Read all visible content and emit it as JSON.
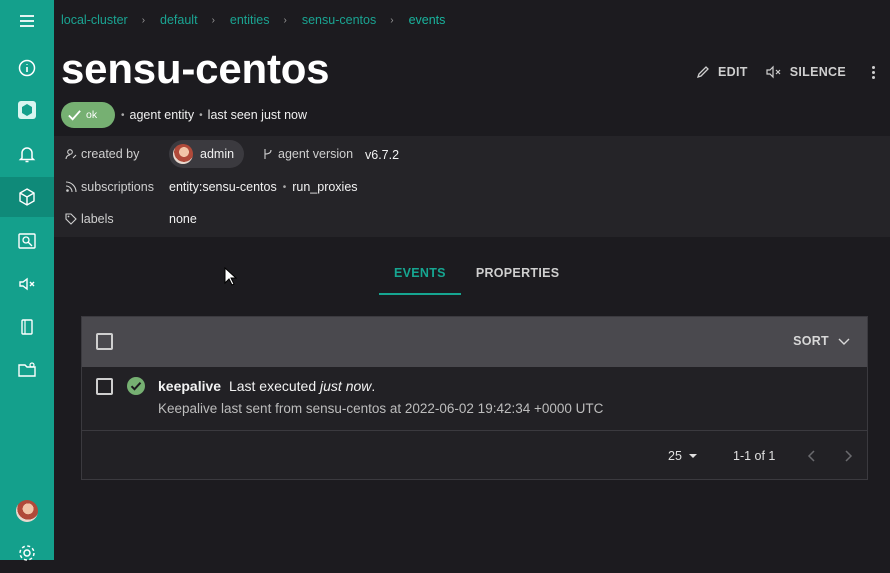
{
  "breadcrumb": [
    "local-cluster",
    "default",
    "entities",
    "sensu-centos",
    "events"
  ],
  "entity": {
    "name": "sensu-centos",
    "status": "ok",
    "class": "agent entity",
    "last_seen": "last seen just now"
  },
  "actions": {
    "edit": "EDIT",
    "silence": "SILENCE"
  },
  "meta": {
    "created_by_label": "created by",
    "created_by": "admin",
    "agent_version_label": "agent version",
    "agent_version": "v6.7.2",
    "subscriptions_label": "subscriptions",
    "subscriptions": [
      "entity:sensu-centos",
      "run_proxies"
    ],
    "labels_label": "labels",
    "labels": "none"
  },
  "tabs": [
    "EVENTS",
    "PROPERTIES"
  ],
  "table": {
    "sort_label": "SORT",
    "rows": [
      {
        "check": "keepalive",
        "summary_prefix": "Last executed",
        "summary_time": "just now",
        "summary_suffix": ".",
        "output": "Keepalive last sent from sensu-centos at 2022-06-02 19:42:34 +0000 UTC",
        "status_color": "#76b072"
      }
    ],
    "per_page": "25",
    "range": "1-1 of 1"
  },
  "colors": {
    "accent": "#14a08c",
    "ok": "#76b072"
  }
}
